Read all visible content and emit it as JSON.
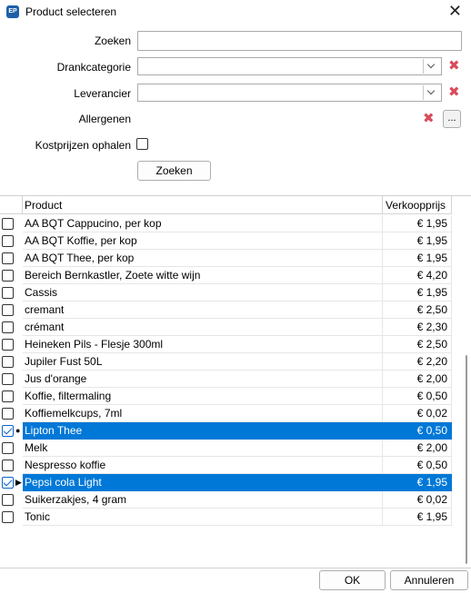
{
  "window": {
    "icon_label": "EP",
    "title": "Product selecteren",
    "close_glyph": "✕"
  },
  "form": {
    "search_label": "Zoeken",
    "search_value": "",
    "category_label": "Drankcategorie",
    "category_value": "",
    "supplier_label": "Leverancier",
    "supplier_value": "",
    "allergens_label": "Allergenen",
    "allergens_button": "...",
    "cost_label": "Kostprijzen ophalen",
    "cost_checked": false,
    "clear_glyph": "✖",
    "search_button": "Zoeken"
  },
  "grid": {
    "columns": [
      "Product",
      "Verkoopprijs"
    ],
    "rows": [
      {
        "product": "AA BQT Cappucino, per kop",
        "price": "€ 1,95",
        "checked": false,
        "selected": false,
        "indicator": ""
      },
      {
        "product": "AA BQT Koffie, per kop",
        "price": "€ 1,95",
        "checked": false,
        "selected": false,
        "indicator": ""
      },
      {
        "product": "AA BQT Thee, per kop",
        "price": "€ 1,95",
        "checked": false,
        "selected": false,
        "indicator": ""
      },
      {
        "product": "Bereich Bernkastler, Zoete witte wijn",
        "price": "€ 4,20",
        "checked": false,
        "selected": false,
        "indicator": ""
      },
      {
        "product": "Cassis",
        "price": "€ 1,95",
        "checked": false,
        "selected": false,
        "indicator": ""
      },
      {
        "product": "cremant",
        "price": "€ 2,50",
        "checked": false,
        "selected": false,
        "indicator": ""
      },
      {
        "product": "crémant",
        "price": "€ 2,30",
        "checked": false,
        "selected": false,
        "indicator": ""
      },
      {
        "product": "Heineken Pils - Flesje 300ml",
        "price": "€ 2,50",
        "checked": false,
        "selected": false,
        "indicator": ""
      },
      {
        "product": "Jupiler Fust 50L",
        "price": "€ 2,20",
        "checked": false,
        "selected": false,
        "indicator": ""
      },
      {
        "product": "Jus d'orange",
        "price": "€ 2,00",
        "checked": false,
        "selected": false,
        "indicator": ""
      },
      {
        "product": "Koffie, filtermaling",
        "price": "€ 0,50",
        "checked": false,
        "selected": false,
        "indicator": ""
      },
      {
        "product": "Koffiemelkcups, 7ml",
        "price": "€ 0,02",
        "checked": false,
        "selected": false,
        "indicator": ""
      },
      {
        "product": "Lipton Thee",
        "price": "€ 0,50",
        "checked": true,
        "selected": true,
        "indicator": "●"
      },
      {
        "product": "Melk",
        "price": "€ 2,00",
        "checked": false,
        "selected": false,
        "indicator": ""
      },
      {
        "product": "Nespresso koffie",
        "price": "€ 0,50",
        "checked": false,
        "selected": false,
        "indicator": ""
      },
      {
        "product": "Pepsi cola Light",
        "price": "€ 1,95",
        "checked": true,
        "selected": true,
        "indicator": "▶"
      },
      {
        "product": "Suikerzakjes, 4 gram",
        "price": "€ 0,02",
        "checked": false,
        "selected": false,
        "indicator": ""
      },
      {
        "product": "Tonic",
        "price": "€ 1,95",
        "checked": false,
        "selected": false,
        "indicator": ""
      }
    ]
  },
  "footer": {
    "ok_label": "OK",
    "cancel_label": "Annuleren"
  },
  "colors": {
    "selection": "#0078d7",
    "clear_icon": "#d94b5c",
    "app_icon": "#1e5fa8"
  }
}
